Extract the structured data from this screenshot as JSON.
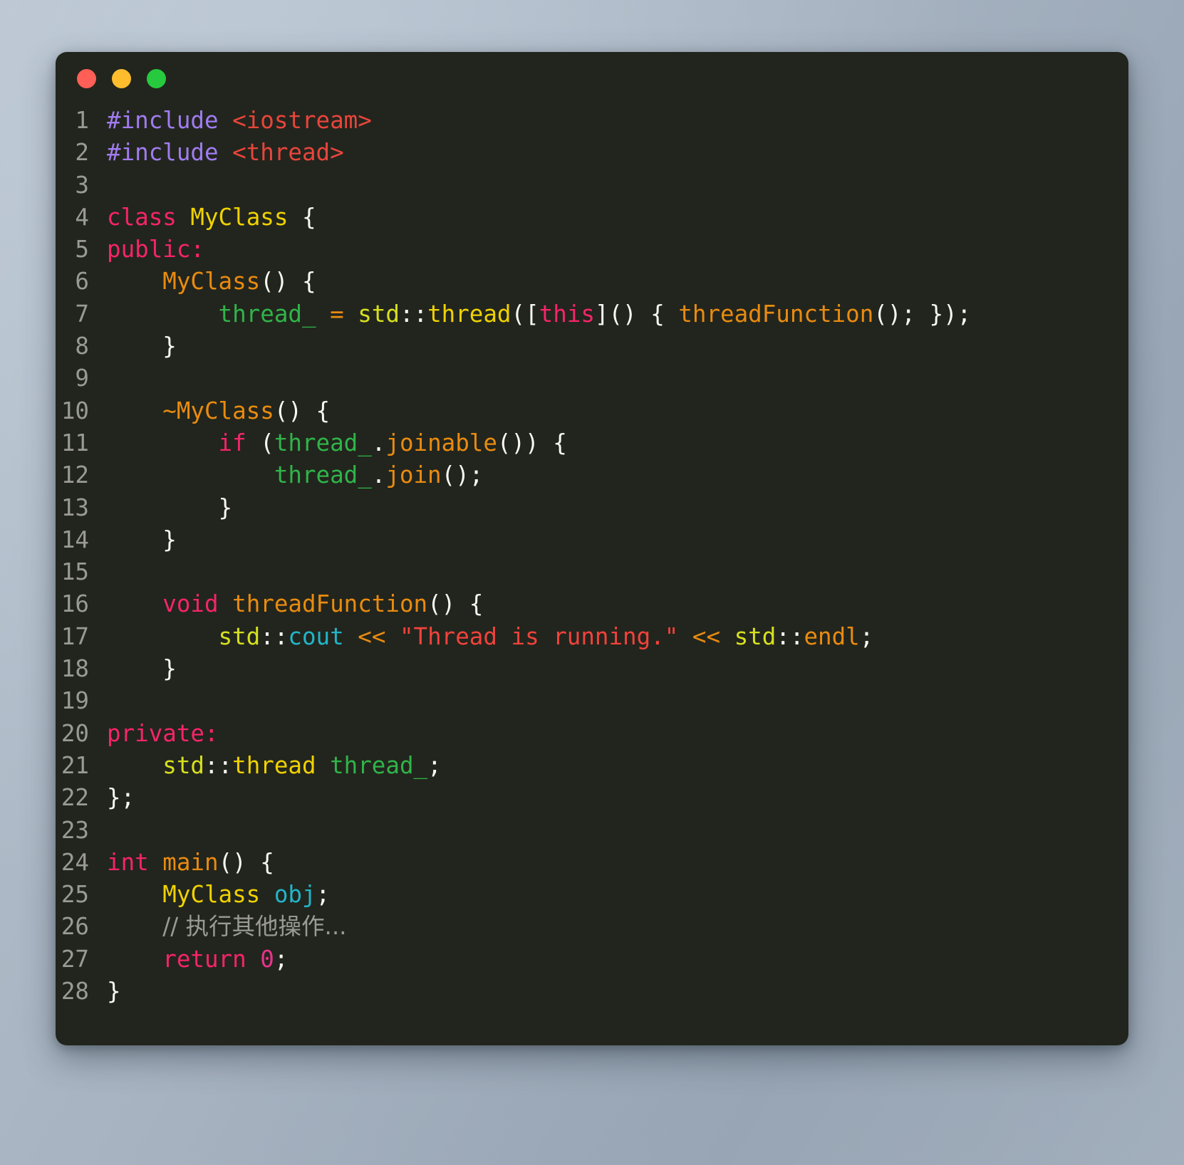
{
  "window": {
    "traffic_lights": [
      {
        "name": "close",
        "color": "#ff5f56"
      },
      {
        "name": "minimize",
        "color": "#ffbd2e"
      },
      {
        "name": "maximize",
        "color": "#27c93f"
      }
    ],
    "background_color": "#22251d",
    "language": "C++"
  },
  "editor": {
    "lines": [
      {
        "number": "1",
        "tokens": [
          {
            "t": "#include",
            "c": "pre"
          },
          {
            "t": " ",
            "c": "punct"
          },
          {
            "t": "<iostream>",
            "c": "hdr"
          }
        ]
      },
      {
        "number": "2",
        "tokens": [
          {
            "t": "#include",
            "c": "pre"
          },
          {
            "t": " ",
            "c": "punct"
          },
          {
            "t": "<thread>",
            "c": "hdr"
          }
        ]
      },
      {
        "number": "3",
        "tokens": []
      },
      {
        "number": "4",
        "tokens": [
          {
            "t": "class",
            "c": "kw"
          },
          {
            "t": " ",
            "c": "punct"
          },
          {
            "t": "MyClass",
            "c": "type"
          },
          {
            "t": " {",
            "c": "punct"
          }
        ]
      },
      {
        "number": "5",
        "tokens": [
          {
            "t": "public",
            "c": "kw"
          },
          {
            "t": ":",
            "c": "kw"
          }
        ]
      },
      {
        "number": "6",
        "tokens": [
          {
            "t": "    ",
            "c": "punct"
          },
          {
            "t": "MyClass",
            "c": "fn"
          },
          {
            "t": "() {",
            "c": "punct"
          }
        ]
      },
      {
        "number": "7",
        "tokens": [
          {
            "t": "        ",
            "c": "punct"
          },
          {
            "t": "thread_",
            "c": "var"
          },
          {
            "t": " ",
            "c": "punct"
          },
          {
            "t": "=",
            "c": "op"
          },
          {
            "t": " ",
            "c": "punct"
          },
          {
            "t": "std",
            "c": "ns"
          },
          {
            "t": "::",
            "c": "punct"
          },
          {
            "t": "thread",
            "c": "type"
          },
          {
            "t": "([",
            "c": "punct"
          },
          {
            "t": "this",
            "c": "kw"
          },
          {
            "t": "]() { ",
            "c": "punct"
          },
          {
            "t": "threadFunction",
            "c": "fn"
          },
          {
            "t": "(); });",
            "c": "punct"
          }
        ]
      },
      {
        "number": "8",
        "tokens": [
          {
            "t": "    }",
            "c": "punct"
          }
        ]
      },
      {
        "number": "9",
        "tokens": []
      },
      {
        "number": "10",
        "tokens": [
          {
            "t": "    ",
            "c": "punct"
          },
          {
            "t": "~MyClass",
            "c": "fn"
          },
          {
            "t": "() {",
            "c": "punct"
          }
        ]
      },
      {
        "number": "11",
        "tokens": [
          {
            "t": "        ",
            "c": "punct"
          },
          {
            "t": "if",
            "c": "kw"
          },
          {
            "t": " (",
            "c": "punct"
          },
          {
            "t": "thread_",
            "c": "var"
          },
          {
            "t": ".",
            "c": "punct"
          },
          {
            "t": "joinable",
            "c": "fn"
          },
          {
            "t": "()) {",
            "c": "punct"
          }
        ]
      },
      {
        "number": "12",
        "tokens": [
          {
            "t": "            ",
            "c": "punct"
          },
          {
            "t": "thread_",
            "c": "var"
          },
          {
            "t": ".",
            "c": "punct"
          },
          {
            "t": "join",
            "c": "fn"
          },
          {
            "t": "();",
            "c": "punct"
          }
        ]
      },
      {
        "number": "13",
        "tokens": [
          {
            "t": "        }",
            "c": "punct"
          }
        ]
      },
      {
        "number": "14",
        "tokens": [
          {
            "t": "    }",
            "c": "punct"
          }
        ]
      },
      {
        "number": "15",
        "tokens": []
      },
      {
        "number": "16",
        "tokens": [
          {
            "t": "    ",
            "c": "punct"
          },
          {
            "t": "void",
            "c": "kw"
          },
          {
            "t": " ",
            "c": "punct"
          },
          {
            "t": "threadFunction",
            "c": "fn"
          },
          {
            "t": "() {",
            "c": "punct"
          }
        ]
      },
      {
        "number": "17",
        "tokens": [
          {
            "t": "        ",
            "c": "punct"
          },
          {
            "t": "std",
            "c": "ns"
          },
          {
            "t": "::",
            "c": "punct"
          },
          {
            "t": "cout",
            "c": "member"
          },
          {
            "t": " ",
            "c": "punct"
          },
          {
            "t": "<<",
            "c": "op"
          },
          {
            "t": " ",
            "c": "punct"
          },
          {
            "t": "\"Thread is running.\"",
            "c": "str"
          },
          {
            "t": " ",
            "c": "punct"
          },
          {
            "t": "<<",
            "c": "op"
          },
          {
            "t": " ",
            "c": "punct"
          },
          {
            "t": "std",
            "c": "ns"
          },
          {
            "t": "::",
            "c": "punct"
          },
          {
            "t": "endl",
            "c": "fn"
          },
          {
            "t": ";",
            "c": "punct"
          }
        ]
      },
      {
        "number": "18",
        "tokens": [
          {
            "t": "    }",
            "c": "punct"
          }
        ]
      },
      {
        "number": "19",
        "tokens": []
      },
      {
        "number": "20",
        "tokens": [
          {
            "t": "private",
            "c": "kw"
          },
          {
            "t": ":",
            "c": "kw"
          }
        ]
      },
      {
        "number": "21",
        "tokens": [
          {
            "t": "    ",
            "c": "punct"
          },
          {
            "t": "std",
            "c": "ns"
          },
          {
            "t": "::",
            "c": "punct"
          },
          {
            "t": "thread",
            "c": "type"
          },
          {
            "t": " ",
            "c": "punct"
          },
          {
            "t": "thread_",
            "c": "var"
          },
          {
            "t": ";",
            "c": "punct"
          }
        ]
      },
      {
        "number": "22",
        "tokens": [
          {
            "t": "};",
            "c": "punct"
          }
        ]
      },
      {
        "number": "23",
        "tokens": []
      },
      {
        "number": "24",
        "tokens": [
          {
            "t": "int",
            "c": "kw"
          },
          {
            "t": " ",
            "c": "punct"
          },
          {
            "t": "main",
            "c": "fn"
          },
          {
            "t": "() {",
            "c": "punct"
          }
        ]
      },
      {
        "number": "25",
        "tokens": [
          {
            "t": "    ",
            "c": "punct"
          },
          {
            "t": "MyClass",
            "c": "type"
          },
          {
            "t": " ",
            "c": "punct"
          },
          {
            "t": "obj",
            "c": "member"
          },
          {
            "t": ";",
            "c": "punct"
          }
        ]
      },
      {
        "number": "26",
        "tokens": [
          {
            "t": "    ",
            "c": "punct"
          },
          {
            "t": "// 执行其他操作...",
            "c": "cmt cjk"
          }
        ]
      },
      {
        "number": "27",
        "tokens": [
          {
            "t": "    ",
            "c": "punct"
          },
          {
            "t": "return",
            "c": "kw"
          },
          {
            "t": " ",
            "c": "punct"
          },
          {
            "t": "0",
            "c": "num"
          },
          {
            "t": ";",
            "c": "punct"
          }
        ]
      },
      {
        "number": "28",
        "tokens": [
          {
            "t": "}",
            "c": "punct"
          }
        ]
      }
    ]
  }
}
